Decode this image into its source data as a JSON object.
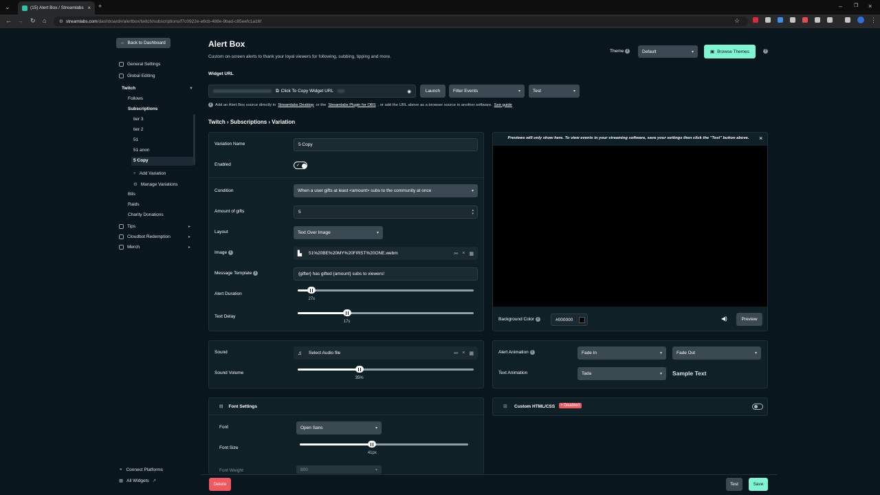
{
  "browser": {
    "tab_title": "(15) Alert Box / Streamlabs",
    "url_host": "streamlabs.com",
    "url_path": "/dashboard#/alertbox/twitch/subscriptions/f7c0922e-e6cb-488e-9bad-c85eefc1a16f"
  },
  "sidebar": {
    "back_label": "Back to Dashboard",
    "general_settings": "General Settings",
    "global_editing": "Global Editing",
    "twitch": "Twitch",
    "follows": "Follows",
    "subscriptions": "Subscriptions",
    "variations": [
      "tier 3",
      "tier 2",
      "51",
      "51 anon",
      "5 Copy"
    ],
    "add_variation": "Add Variation",
    "manage_variations": "Manage Variations",
    "bits": "Bits",
    "raids": "Raids",
    "charity_donations": "Charity Donations",
    "tips": "Tips",
    "cloudbot": "Cloudbot Redemption",
    "merch": "Merch",
    "connect_platforms": "Connect Platforms",
    "all_widgets": "All Widgets"
  },
  "header": {
    "title": "Alert Box",
    "subtitle": "Custom on-screen alerts to thank your loyal viewers for following, subbing, tipping and more.",
    "theme_label": "Theme",
    "theme_value": "Default",
    "browse_themes": "Browse Themes"
  },
  "widget_url": {
    "label": "Widget URL",
    "copy_label": "Click To Copy Widget URL",
    "launch": "Launch",
    "filter_events": "Filter Events",
    "test": "Test",
    "hint_a": "Add an Alert Box source directly in",
    "hint_link1": "Streamlabs Desktop",
    "hint_b": "or the",
    "hint_link2": "Streamlabs Plugin for OBS",
    "hint_c": ", or add the URL above as a browser source in another software.",
    "hint_link3": "See guide"
  },
  "breadcrumb": "Twitch › Subscriptions › Variation",
  "form": {
    "variation_name_label": "Variation Name",
    "variation_name_value": "5 Copy",
    "enabled_label": "Enabled",
    "condition_label": "Condition",
    "condition_value": "When a user gifts at least <amount> subs to the community at once",
    "amount_label": "Amount of gifts",
    "amount_value": "5",
    "layout_label": "Layout",
    "layout_value": "Text Over Image",
    "image_label": "Image",
    "image_value": "51%20BE%20MY%20FIRST%20ONE.webm",
    "message_label": "Message Template",
    "message_value": "{gifter} has gifted {amount} subs to viewers!",
    "alert_duration_label": "Alert Duration",
    "alert_duration_value": "27s",
    "alert_duration_fraction": 0.08,
    "text_delay_label": "Text Delay",
    "text_delay_value": "17s",
    "text_delay_fraction": 0.28
  },
  "sound": {
    "sound_label": "Sound",
    "sound_value": "Select Audio file",
    "volume_label": "Sound Volume",
    "volume_value": "35%",
    "volume_fraction": 0.35
  },
  "font": {
    "section_title": "Font Settings",
    "font_label": "Font",
    "font_value": "Open Sans",
    "size_label": "Font Size",
    "size_value": "41px",
    "size_fraction": 0.43,
    "weight_label": "Font Weight",
    "weight_value": "800"
  },
  "preview": {
    "notice": "Previews will only show here. To view events in your streaming software, save your settings then click the \"Test\" button above.",
    "bg_label": "Background Color",
    "bg_value": "#000000",
    "preview_btn": "Preview"
  },
  "animation": {
    "alert_label": "Alert Animation",
    "in_value": "Fade In",
    "out_value": "Fade Out",
    "text_label": "Text Animation",
    "text_value": "Tada",
    "sample_text": "Sample Text"
  },
  "custom": {
    "title": "Custom HTML/CSS",
    "badge": "• Disabled"
  },
  "footer": {
    "delete": "Delete",
    "test": "Test",
    "save": "Save"
  },
  "colors": {
    "background": "#09161d",
    "accent": "#80f5d2",
    "danger": "#f0595e"
  }
}
